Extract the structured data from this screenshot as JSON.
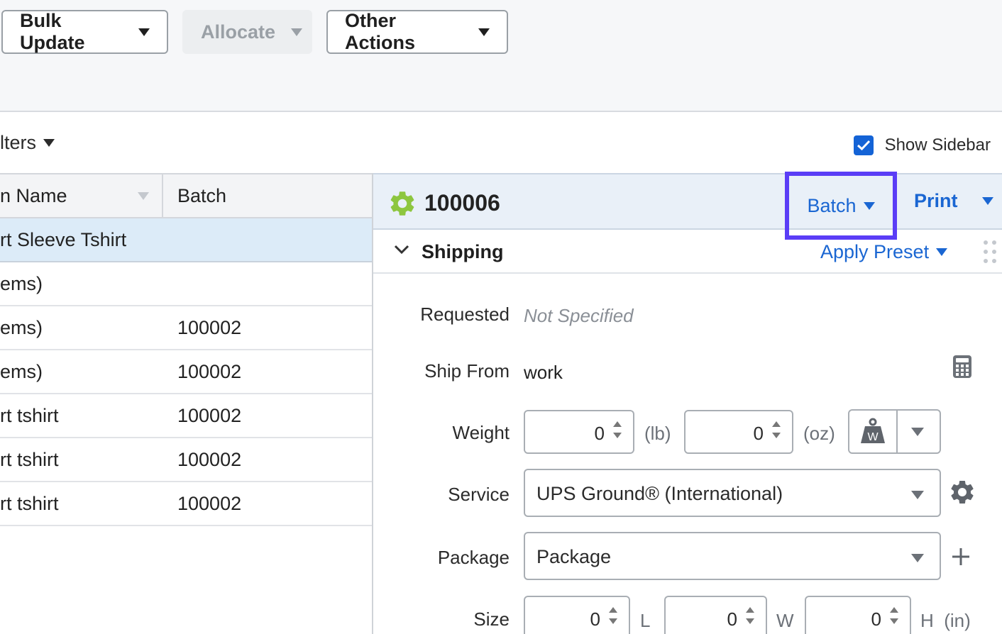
{
  "toolbar": {
    "bulk_update": "Bulk Update",
    "allocate": "Allocate",
    "other_actions": "Other Actions"
  },
  "filters": {
    "label": "lters"
  },
  "sidebar_toggle": {
    "label": "Show Sidebar",
    "checked": true
  },
  "table": {
    "columns": [
      "n Name",
      "Batch"
    ],
    "rows": [
      {
        "name": "rt Sleeve Tshirt",
        "batch": "",
        "selected": true
      },
      {
        "name": "ems)",
        "batch": ""
      },
      {
        "name": "ems)",
        "batch": "100002"
      },
      {
        "name": "ems)",
        "batch": "100002"
      },
      {
        "name": "rt tshirt",
        "batch": "100002"
      },
      {
        "name": "rt tshirt",
        "batch": "100002"
      },
      {
        "name": "rt tshirt",
        "batch": "100002"
      }
    ]
  },
  "panel": {
    "order_number": "100006",
    "batch_label": "Batch",
    "print_label": "Print",
    "section_title": "Shipping",
    "apply_preset": "Apply Preset"
  },
  "shipping": {
    "requested_label": "Requested",
    "requested_value": "Not Specified",
    "ship_from_label": "Ship From",
    "ship_from_value": "work",
    "weight_label": "Weight",
    "weight_lb": "0",
    "weight_lb_unit": "(lb)",
    "weight_oz": "0",
    "weight_oz_unit": "(oz)",
    "scale_letter": "W",
    "service_label": "Service",
    "service_value": "UPS Ground® (International)",
    "package_label": "Package",
    "package_value": "Package",
    "size_label": "Size",
    "size_l": "0",
    "size_l_unit": "L",
    "size_w": "0",
    "size_w_unit": "W",
    "size_h": "0",
    "size_h_unit": "H  (in)"
  },
  "colors": {
    "accent_blue": "#1a66d2",
    "highlight_border": "#5a3df6",
    "status_green": "#8dc63f",
    "selected_row": "#dcebf8"
  },
  "icons": [
    "chevron-down-icon",
    "calculator-icon",
    "scale-icon",
    "gear-icon",
    "plus-icon",
    "drag-handle-icon",
    "check-icon"
  ]
}
